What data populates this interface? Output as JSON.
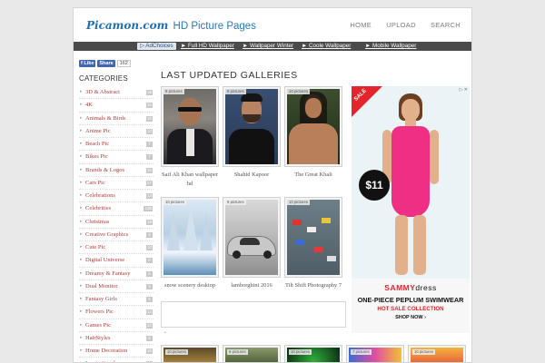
{
  "header": {
    "brand": "Picamon.com",
    "subtitle": "HD Picture Pages",
    "nav": [
      "HOME",
      "UPLOAD",
      "SEARCH"
    ]
  },
  "linkbar": {
    "adchoices": "AdChoices",
    "links": [
      "Full HD Wallpaper",
      "Wallpaper Winter",
      "Coole Wallpaper",
      "Mobile Wallpaper"
    ]
  },
  "sidebar": {
    "like_label": "Like",
    "share_label": "Share",
    "like_count": "162",
    "title": "CATEGORIES",
    "categories": [
      {
        "name": "3D & Abstract",
        "count": "16"
      },
      {
        "name": "4K",
        "count": "16"
      },
      {
        "name": "Animals & Birds",
        "count": "16"
      },
      {
        "name": "Anime Pic",
        "count": "10"
      },
      {
        "name": "Beach Pic",
        "count": "7"
      },
      {
        "name": "Bikes Pic",
        "count": "7"
      },
      {
        "name": "Brands & Logos",
        "count": "16"
      },
      {
        "name": "Cars Pic",
        "count": "27"
      },
      {
        "name": "Celebrations",
        "count": "13"
      },
      {
        "name": "Celebrities",
        "count": "138"
      },
      {
        "name": "Christmas",
        "count": "19"
      },
      {
        "name": "Creative Graphics",
        "count": "6"
      },
      {
        "name": "Cute Pic",
        "count": "10"
      },
      {
        "name": "Digital Universe",
        "count": "8"
      },
      {
        "name": "Dreamy & Fantasy",
        "count": "6"
      },
      {
        "name": "Dual Monitor",
        "count": "2"
      },
      {
        "name": "Fantasy Girls",
        "count": "6"
      },
      {
        "name": "Flowers Pic",
        "count": "12"
      },
      {
        "name": "Games Pic",
        "count": "12"
      },
      {
        "name": "HairStyles",
        "count": "6"
      },
      {
        "name": "Home Decoration",
        "count": "16"
      },
      {
        "name": "Inspirational",
        "count": "5"
      }
    ]
  },
  "main": {
    "title": "LAST UPDATED GALLERIES",
    "galleries": [
      {
        "badge": "8 pictures",
        "caption": "Saif Ali Khan wallpaper hd"
      },
      {
        "badge": "8 pictures",
        "caption": "Shahid Kapoor"
      },
      {
        "badge": "10 pictures",
        "caption": "The Great Khali"
      },
      {
        "badge": "10 pictures",
        "caption": "snow scenery desktop"
      },
      {
        "badge": "9 pictures",
        "caption": "lamborghini 2016"
      },
      {
        "badge": "10 pictures",
        "caption": "Tilt Shift Photography 7"
      }
    ],
    "bottom_badges": [
      "10 pictures",
      "9 pictures",
      "10 pictures",
      "7 pictures",
      "10 pictures"
    ]
  },
  "ad": {
    "sale": "SALE",
    "price": "$11",
    "brand_a": "SAMMY",
    "brand_b": "dress",
    "line1": "ONE-PIECE PEPLUM SWIMWEAR",
    "line2": "HOT SALE COLLECTION",
    "line3": "SHOP NOW ›",
    "controls": "▷ ✕"
  },
  "colors": {
    "brand_blue": "#1e6fb3",
    "category_link": "#b23a3a",
    "linkbar_bg": "#4b4b4b",
    "ad_red": "#e4252b"
  }
}
